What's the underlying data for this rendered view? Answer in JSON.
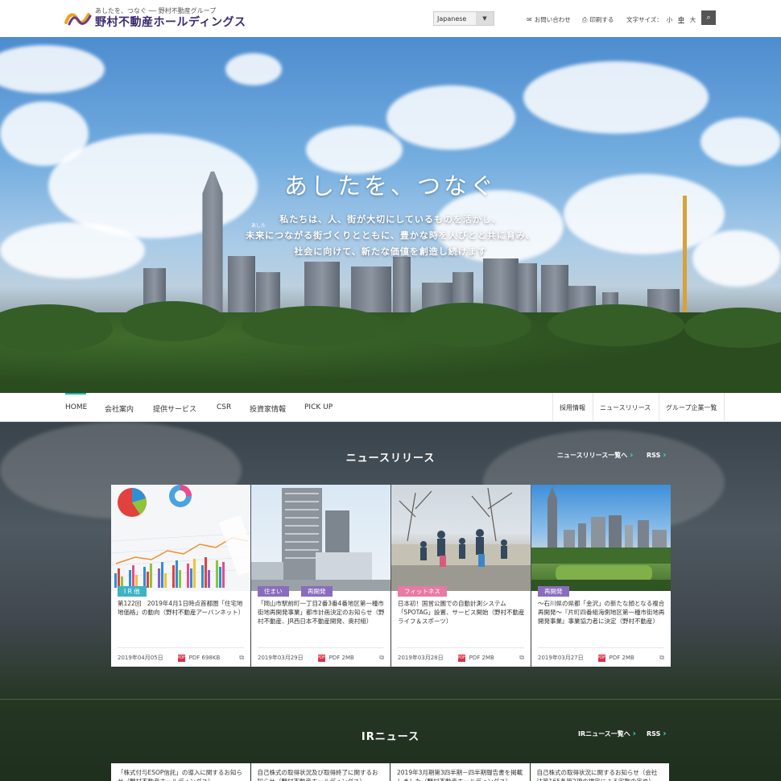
{
  "header": {
    "logo_tagline": "あしたを、つなぐ ── 野村不動産グループ",
    "logo_name": "野村不動産ホールディングス",
    "language": "Japanese",
    "contact": "お問い合わせ",
    "print": "印刷する",
    "font_size_label": "文字サイズ：",
    "font_sizes": [
      "小",
      "中",
      "大"
    ]
  },
  "hero": {
    "title": "あしたを、つなぐ",
    "ruby": "あした",
    "lines": [
      "私たちは、人、街が大切にしているものを活かし、",
      "未来につながる街づくりとともに、豊かな時を人びとと共に育み、",
      "社会に向けて、新たな価値を創造し続けます"
    ]
  },
  "nav": {
    "main": [
      "HOME",
      "会社案内",
      "提供サービス",
      "CSR",
      "投資家情報",
      "PICK UP"
    ],
    "sub": [
      "採用情報",
      "ニュースリリース",
      "グループ企業一覧"
    ]
  },
  "news": {
    "title": "ニュースリリース",
    "list_link": "ニュースリリース一覧へ",
    "rss": "RSS",
    "cards": [
      {
        "badges": [
          "I R 他"
        ],
        "text": "第122回　2019年4月1日時点首都圏「住宅地地価格」の動向（野村不動産アーバンネット）",
        "date": "2019年04月05日",
        "file": "PDF 698KB"
      },
      {
        "badges": [
          "住まい",
          "再開発"
        ],
        "text": "「岡山市駅前町一丁目2番3番4番地区第一種市街地再開発事業」都市計画決定のお知らせ（野村不動産、JR西日本不動産開発、奥村組）",
        "date": "2019年03月29日",
        "file": "PDF 2MB"
      },
      {
        "badges": [
          "フィットネス"
        ],
        "text": "日本初！国営公園での自動計測システム「SPOTAG」設置、サービス開始（野村不動産ライフ＆スポーツ）",
        "date": "2019年03月28日",
        "file": "PDF 2MB"
      },
      {
        "badges": [
          "再開発"
        ],
        "text": "～石川県の県都「金沢」の新たな顔となる複合再開発～『片町四番組海側地区第一種市街地再開発事業』事業協力者に決定（野村不動産）",
        "date": "2019年03月27日",
        "file": "PDF 2MB"
      }
    ]
  },
  "ir": {
    "title": "IRニュース",
    "list_link": "IRニュース一覧へ",
    "rss": "RSS",
    "items": [
      "「株式付与ESOP信託」の導入に関するお知らせ（野村不動産ホールディングス）",
      "自己株式の取得状況及び取得終了に関するお知らせ（野村不動産ホールディングス）",
      "2019年3月期第3四半期－四半期報告書を掲載しました（野村不動産ホールディングス）",
      "自己株式の取得状況に関するお知らせ（会社法第165条第2項の規定による定款の定め）"
    ]
  },
  "colors": {
    "accent": "#19b8a8",
    "brand": "#3a2a6e",
    "badge_teal": "#3fb3c6",
    "badge_purple": "#8a6cbd",
    "badge_pink": "#e87aa4"
  }
}
